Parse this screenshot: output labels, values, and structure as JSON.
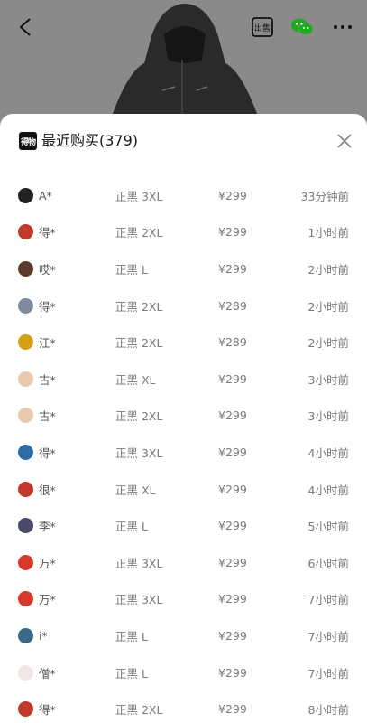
{
  "header": {
    "title": "最近购买(379)",
    "logo_text": "得物",
    "icons": [
      "back-icon",
      "sell-icon",
      "wechat-icon",
      "more-icon",
      "close-icon"
    ],
    "sell_icon_text": "出售"
  },
  "colors": {
    "sheet_bg": "#ffffff",
    "overlay": "#8a8a8a",
    "text_muted": "#7a7a80",
    "wechat_green": "#1aad19"
  },
  "purchases": [
    {
      "name": "A*",
      "spec": "正黑 3XL",
      "price": "¥299",
      "time": "33分钟前",
      "avatar_color": "#222222"
    },
    {
      "name": "得*",
      "spec": "正黑 2XL",
      "price": "¥299",
      "time": "1小时前",
      "avatar_color": "#c0392b"
    },
    {
      "name": "哎*",
      "spec": "正黑 L",
      "price": "¥299",
      "time": "2小时前",
      "avatar_color": "#5a3a2a"
    },
    {
      "name": "得*",
      "spec": "正黑 2XL",
      "price": "¥289",
      "time": "2小时前",
      "avatar_color": "#7f8ca0"
    },
    {
      "name": "江*",
      "spec": "正黑 2XL",
      "price": "¥289",
      "time": "2小时前",
      "avatar_color": "#d4a017"
    },
    {
      "name": "古*",
      "spec": "正黑 XL",
      "price": "¥299",
      "time": "3小时前",
      "avatar_color": "#e8c9b0"
    },
    {
      "name": "古*",
      "spec": "正黑 2XL",
      "price": "¥299",
      "time": "3小时前",
      "avatar_color": "#e8c9b0"
    },
    {
      "name": "得*",
      "spec": "正黑 3XL",
      "price": "¥299",
      "time": "4小时前",
      "avatar_color": "#2e6da4"
    },
    {
      "name": "很*",
      "spec": "正黑 XL",
      "price": "¥299",
      "time": "4小时前",
      "avatar_color": "#c0392b"
    },
    {
      "name": "李*",
      "spec": "正黑 L",
      "price": "¥299",
      "time": "5小时前",
      "avatar_color": "#4a4a6a"
    },
    {
      "name": "万*",
      "spec": "正黑 3XL",
      "price": "¥299",
      "time": "6小时前",
      "avatar_color": "#d63a2a"
    },
    {
      "name": "万*",
      "spec": "正黑 3XL",
      "price": "¥299",
      "time": "7小时前",
      "avatar_color": "#d63a2a"
    },
    {
      "name": "i*",
      "spec": "正黑 L",
      "price": "¥299",
      "time": "7小时前",
      "avatar_color": "#3a6a8a"
    },
    {
      "name": "僧*",
      "spec": "正黑 L",
      "price": "¥299",
      "time": "7小时前",
      "avatar_color": "#f2e6e6"
    },
    {
      "name": "得*",
      "spec": "正黑 2XL",
      "price": "¥299",
      "time": "8小时前",
      "avatar_color": "#c0392b"
    }
  ]
}
